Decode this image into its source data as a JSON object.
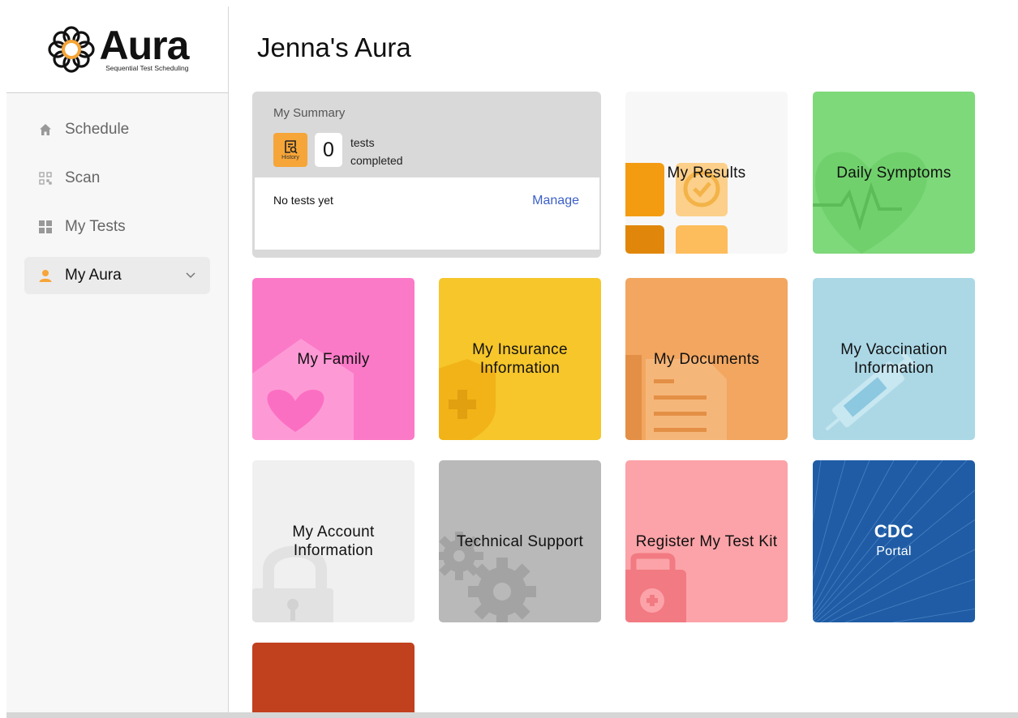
{
  "brand": {
    "name": "Aura",
    "tagline": "Sequential Test Scheduling",
    "accent": "#f6a538"
  },
  "sidebar": {
    "items": [
      {
        "label": "Schedule",
        "icon": "home-icon"
      },
      {
        "label": "Scan",
        "icon": "qr-code-icon"
      },
      {
        "label": "My Tests",
        "icon": "grid-icon"
      },
      {
        "label": "My Aura",
        "icon": "user-icon",
        "active": true,
        "icon_color": "#f6a538"
      }
    ]
  },
  "page": {
    "title": "Jenna's Aura"
  },
  "summary": {
    "title": "My Summary",
    "history_label": "History",
    "count": "0",
    "count_label": "tests completed",
    "empty_text": "No tests yet",
    "manage_label": "Manage"
  },
  "tiles": [
    {
      "id": "my-results",
      "label": "My Results",
      "color": "#f7f7f7"
    },
    {
      "id": "daily-symptoms",
      "label": "Daily Symptoms",
      "color": "#7ed97a"
    },
    {
      "id": "my-family",
      "label": "My Family",
      "color": "#fb7ac8"
    },
    {
      "id": "my-insurance",
      "label": "My Insurance Information",
      "color": "#f6c62a"
    },
    {
      "id": "my-documents",
      "label": "My Documents",
      "color": "#f2a660"
    },
    {
      "id": "my-vaccination",
      "label": "My Vaccination Information",
      "color": "#acd8e6"
    },
    {
      "id": "my-account",
      "label": "My Account Information",
      "color": "#f0f0f0"
    },
    {
      "id": "technical-support",
      "label": "Technical Support",
      "color": "#b9b9b9"
    },
    {
      "id": "register-test-kit",
      "label": "Register My Test Kit",
      "color": "#fba3a8"
    },
    {
      "id": "cdc-portal",
      "title": "CDC",
      "subtitle": "Portal",
      "color": "#1f5ca5"
    },
    {
      "id": "extra-tile",
      "color": "#c1401e"
    }
  ]
}
